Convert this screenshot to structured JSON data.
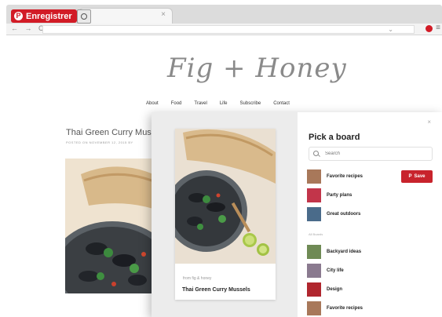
{
  "extension": {
    "save_label": "Enregistrer",
    "pinterest_logo": "P"
  },
  "browser": {
    "tab_close": "×",
    "nav_icons": "← → C",
    "menu_icon": "≡"
  },
  "site": {
    "logo": "Fig + Honey",
    "nav": [
      "About",
      "Food",
      "Travel",
      "Life",
      "Subscribe",
      "Contact"
    ],
    "post_title": "Thai Green Curry Muss",
    "post_meta": "POSTED ON NOVEMBER 12, 2015 BY"
  },
  "modal": {
    "close_icon": "×",
    "pick_title": "Pick a board",
    "search_placeholder": "Search",
    "save_label": "Save",
    "save_icon": "P",
    "pin_source": "from fig & honey",
    "pin_title": "Thai Green Curry Mussels",
    "top_boards": [
      {
        "name": "Favorite recipes",
        "thumb_color": "#a8785a"
      },
      {
        "name": "Party plans",
        "thumb_color": "#c2354a"
      },
      {
        "name": "Great outdoors",
        "thumb_color": "#4a6b8a"
      }
    ],
    "all_boards_label": "All Boards",
    "all_boards": [
      {
        "name": "Backyard ideas",
        "thumb_color": "#6f8a55"
      },
      {
        "name": "City life",
        "thumb_color": "#8a7a8f"
      },
      {
        "name": "Design",
        "thumb_color": "#b0262e"
      },
      {
        "name": "Favorite recipes",
        "thumb_color": "#a8785a"
      }
    ]
  }
}
